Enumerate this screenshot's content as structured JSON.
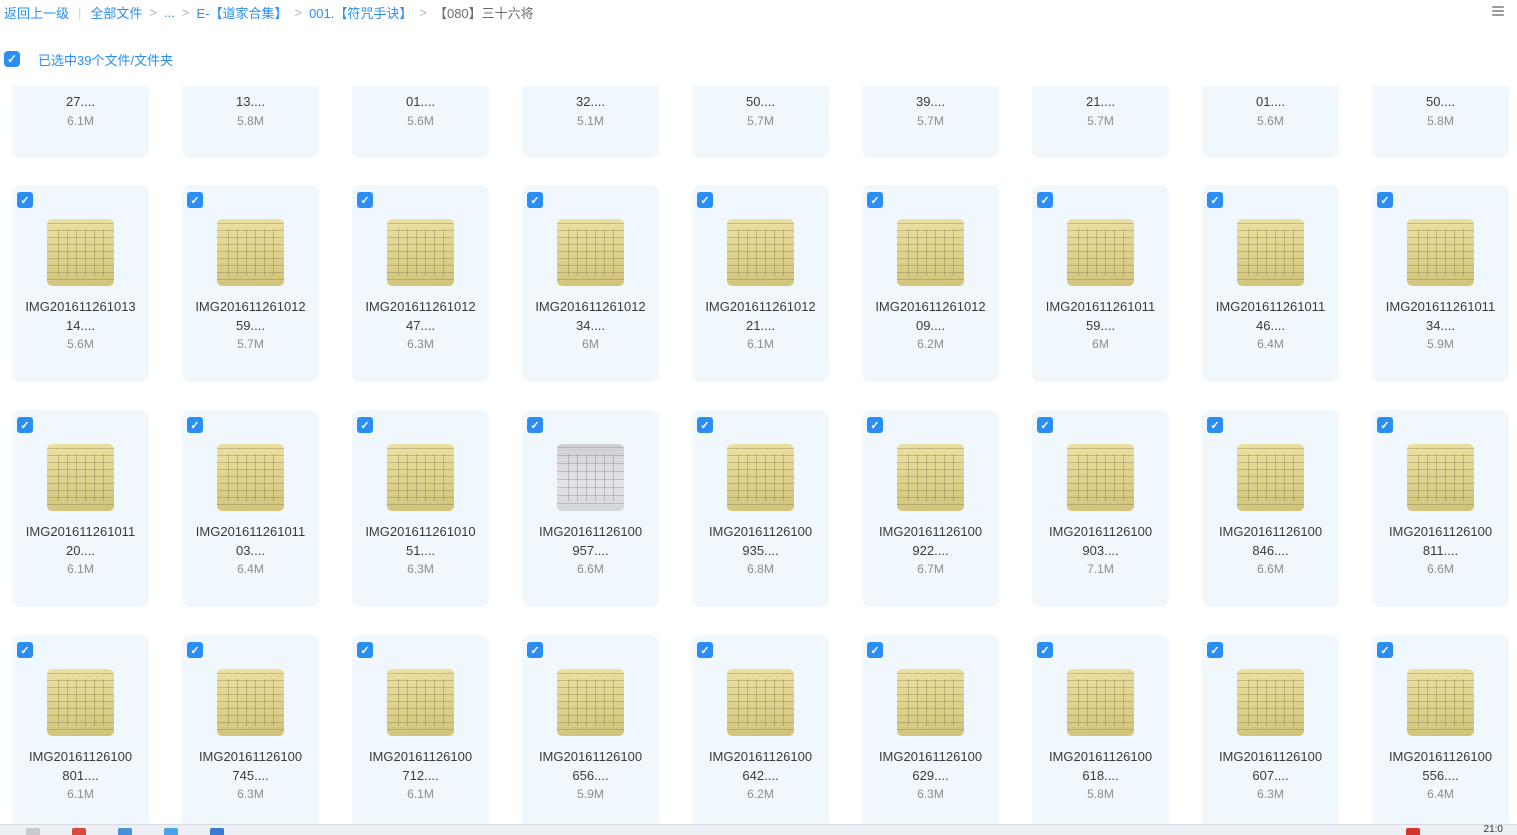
{
  "breadcrumb": {
    "back": "返回上一级",
    "root": "全部文件",
    "ellipsis": "...",
    "level1": "E-【道家合集】",
    "level2": "001.【符咒手诀】",
    "current": "【080】三十六将",
    "separator": ">"
  },
  "selection": {
    "text": "已选中39个文件/文件夹"
  },
  "check_glyph": "✓",
  "rows": [
    {
      "partial": true,
      "items": [
        {
          "name": [
            "27...."
          ],
          "size": "6.1M"
        },
        {
          "name": [
            "13...."
          ],
          "size": "5.8M"
        },
        {
          "name": [
            "01...."
          ],
          "size": "5.6M"
        },
        {
          "name": [
            "32...."
          ],
          "size": "5.1M"
        },
        {
          "name": [
            "50...."
          ],
          "size": "5.7M"
        },
        {
          "name": [
            "39...."
          ],
          "size": "5.7M"
        },
        {
          "name": [
            "21...."
          ],
          "size": "5.7M"
        },
        {
          "name": [
            "01...."
          ],
          "size": "5.6M"
        },
        {
          "name": [
            "50...."
          ],
          "size": "5.8M"
        }
      ]
    },
    {
      "partial": false,
      "items": [
        {
          "name": [
            "IMG201611261013",
            "14...."
          ],
          "size": "5.6M"
        },
        {
          "name": [
            "IMG201611261012",
            "59...."
          ],
          "size": "5.7M"
        },
        {
          "name": [
            "IMG201611261012",
            "47...."
          ],
          "size": "6.3M"
        },
        {
          "name": [
            "IMG201611261012",
            "34...."
          ],
          "size": "6M"
        },
        {
          "name": [
            "IMG201611261012",
            "21...."
          ],
          "size": "6.1M"
        },
        {
          "name": [
            "IMG201611261012",
            "09...."
          ],
          "size": "6.2M"
        },
        {
          "name": [
            "IMG201611261011",
            "59...."
          ],
          "size": "6M"
        },
        {
          "name": [
            "IMG201611261011",
            "46...."
          ],
          "size": "6.4M"
        },
        {
          "name": [
            "IMG201611261011",
            "34...."
          ],
          "size": "5.9M"
        }
      ]
    },
    {
      "partial": false,
      "items": [
        {
          "name": [
            "IMG201611261011",
            "20...."
          ],
          "size": "6.1M"
        },
        {
          "name": [
            "IMG201611261011",
            "03...."
          ],
          "size": "6.4M"
        },
        {
          "name": [
            "IMG201611261010",
            "51...."
          ],
          "size": "6.3M"
        },
        {
          "name": [
            "IMG20161126100",
            "957...."
          ],
          "size": "6.6M",
          "thumb": "gray"
        },
        {
          "name": [
            "IMG20161126100",
            "935...."
          ],
          "size": "6.8M"
        },
        {
          "name": [
            "IMG20161126100",
            "922...."
          ],
          "size": "6.7M"
        },
        {
          "name": [
            "IMG20161126100",
            "903...."
          ],
          "size": "7.1M"
        },
        {
          "name": [
            "IMG20161126100",
            "846...."
          ],
          "size": "6.6M"
        },
        {
          "name": [
            "IMG20161126100",
            "811...."
          ],
          "size": "6.6M"
        }
      ]
    },
    {
      "partial": false,
      "items": [
        {
          "name": [
            "IMG20161126100",
            "801...."
          ],
          "size": "6.1M"
        },
        {
          "name": [
            "IMG20161126100",
            "745...."
          ],
          "size": "6.3M"
        },
        {
          "name": [
            "IMG20161126100",
            "712...."
          ],
          "size": "6.1M"
        },
        {
          "name": [
            "IMG20161126100",
            "656...."
          ],
          "size": "5.9M"
        },
        {
          "name": [
            "IMG20161126100",
            "642...."
          ],
          "size": "6.2M"
        },
        {
          "name": [
            "IMG20161126100",
            "629...."
          ],
          "size": "6.3M"
        },
        {
          "name": [
            "IMG20161126100",
            "618...."
          ],
          "size": "5.8M"
        },
        {
          "name": [
            "IMG20161126100",
            "607...."
          ],
          "size": "6.3M"
        },
        {
          "name": [
            "IMG20161126100",
            "556...."
          ],
          "size": "6.4M"
        }
      ]
    }
  ],
  "taskbar": {
    "clock": "21:0"
  }
}
